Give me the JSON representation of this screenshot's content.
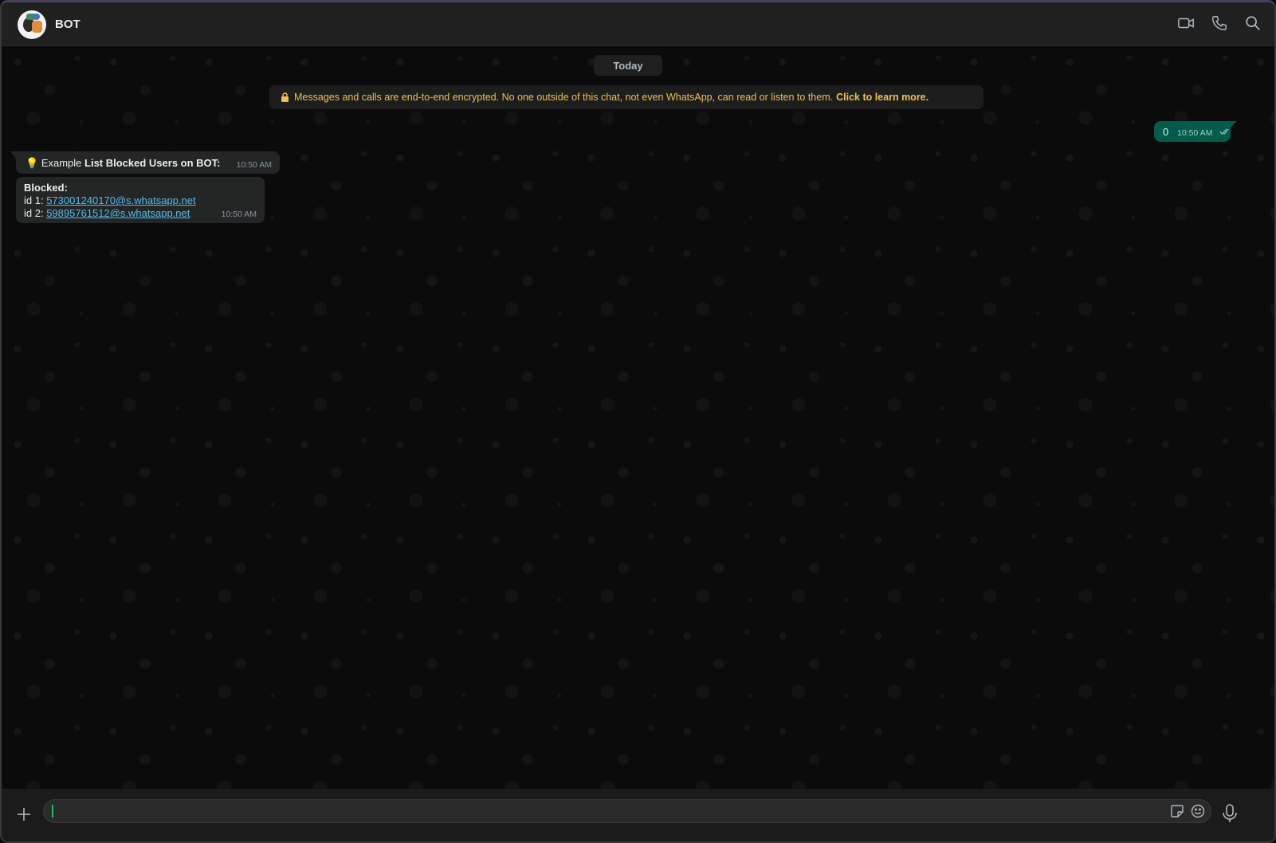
{
  "header": {
    "chat_title": "BOT",
    "icons": [
      "video-call-icon",
      "voice-call-icon",
      "search-icon"
    ]
  },
  "chat": {
    "date_label": "Today",
    "encryption_notice": "Messages and calls are end-to-end encrypted. No one outside of this chat, not even WhatsApp, can read or listen to them.",
    "encryption_link": "Click to learn more.",
    "messages": [
      {
        "direction": "outgoing",
        "text": "0",
        "time": "10:50 AM",
        "status": "read"
      },
      {
        "direction": "incoming",
        "emoji": "💡",
        "prefix": "Example ",
        "bold_text": "List Blocked Users on BOT:",
        "time": "10:50 AM"
      },
      {
        "direction": "incoming",
        "heading": "Blocked:",
        "line1_label": "id 1: ",
        "line1_link": "573001240170@s.whatsapp.net",
        "line2_label": "id 2: ",
        "line2_link": "59895761512@s.whatsapp.net",
        "time": "10:50 AM"
      }
    ]
  },
  "composer": {
    "placeholder": "",
    "value": ""
  },
  "colors": {
    "outgoing_bubble": "#005c4b",
    "incoming_bubble": "#242626",
    "link": "#53bdeb",
    "encryption_text": "#f3c04c",
    "accent_green": "#21c063"
  }
}
